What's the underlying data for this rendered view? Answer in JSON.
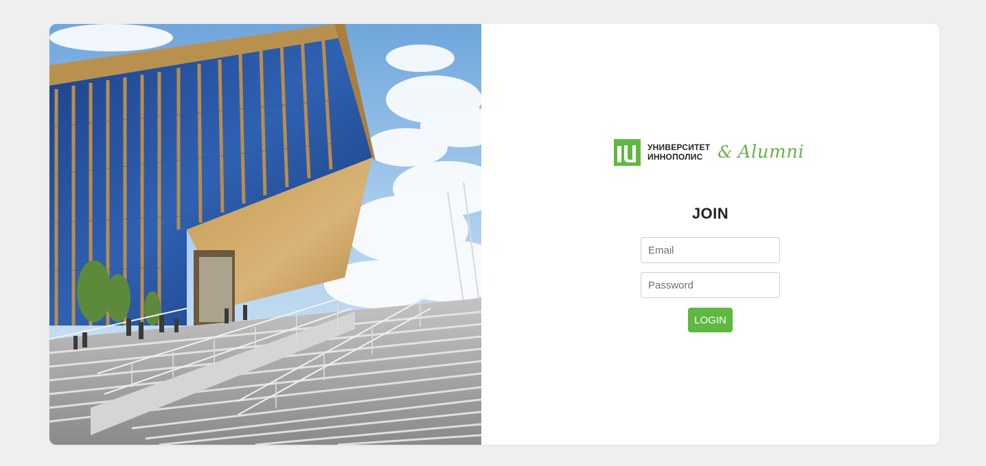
{
  "brand": {
    "name_line1": "УНИВЕРСИТЕТ",
    "name_line2": "ИННОПОЛИС",
    "ampersand": "&",
    "suffix": "Alumni",
    "accent_color": "#5fb83f"
  },
  "form": {
    "title": "JOIN",
    "email_placeholder": "Email",
    "password_placeholder": "Password",
    "login_label": "LOGIN"
  },
  "photo": {
    "subject": "building-with-stairs-photo"
  }
}
